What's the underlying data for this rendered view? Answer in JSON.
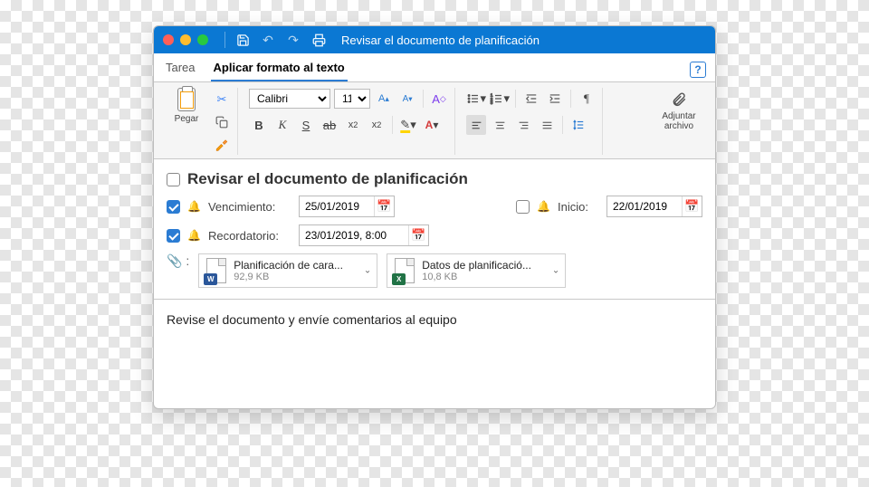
{
  "window": {
    "title": "Revisar el documento de planificación"
  },
  "tabs": [
    {
      "label": "Tarea",
      "active": false
    },
    {
      "label": "Aplicar formato al texto",
      "active": true
    }
  ],
  "ribbon": {
    "paste_label": "Pegar",
    "font_name": "Calibri",
    "font_size": "11",
    "attach_label": "Adjuntar archivo"
  },
  "task": {
    "subject": "Revisar el documento de planificación",
    "complete_checked": false,
    "due": {
      "checked": true,
      "label": "Vencimiento:",
      "value": "25/01/2019"
    },
    "start": {
      "checked": false,
      "label": "Inicio:",
      "value": "22/01/2019"
    },
    "reminder": {
      "checked": true,
      "label": "Recordatorio:",
      "value": "23/01/2019, 8:00"
    }
  },
  "attachments": [
    {
      "name": "Planificación de cara...",
      "size": "92,9 KB",
      "type": "word",
      "badge": "W"
    },
    {
      "name": "Datos de planificació...",
      "size": "10,8 KB",
      "type": "excel",
      "badge": "X"
    }
  ],
  "body": {
    "text": "Revise el documento y envíe comentarios al equipo"
  }
}
